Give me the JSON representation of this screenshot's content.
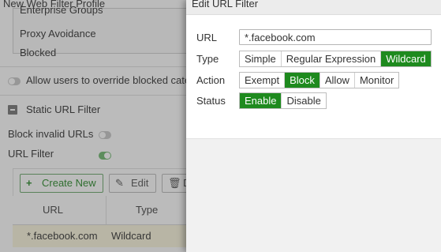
{
  "background": {
    "profile_title": "New Web Filter Profile",
    "categories": [
      "Enterprise Groups",
      "Proxy Avoidance",
      "Blocked"
    ],
    "override_label": "Allow users to override blocked categories",
    "static_url_filter_label": "Static URL Filter",
    "block_invalid_label": "Block invalid URLs",
    "block_invalid_enabled": false,
    "url_filter_label": "URL Filter",
    "url_filter_enabled": true,
    "toolbar": {
      "create_label": "Create New",
      "edit_label": "Edit",
      "delete_label": "D"
    },
    "table": {
      "columns": [
        "URL",
        "Type"
      ],
      "rows": [
        {
          "url": "*.facebook.com",
          "type": "Wildcard"
        }
      ]
    }
  },
  "dialog": {
    "title": "Edit URL Filter",
    "url_label": "URL",
    "url_value": "*.facebook.com",
    "type_label": "Type",
    "type_options": [
      "Simple",
      "Regular Expression",
      "Wildcard"
    ],
    "type_selected": "Wildcard",
    "action_label": "Action",
    "action_options": [
      "Exempt",
      "Block",
      "Allow",
      "Monitor"
    ],
    "action_selected": "Block",
    "status_label": "Status",
    "status_options": [
      "Enable",
      "Disable"
    ],
    "status_selected": "Enable"
  },
  "colors": {
    "accent_green": "#1e8a1e",
    "row_highlight": "#fbf6dd"
  }
}
